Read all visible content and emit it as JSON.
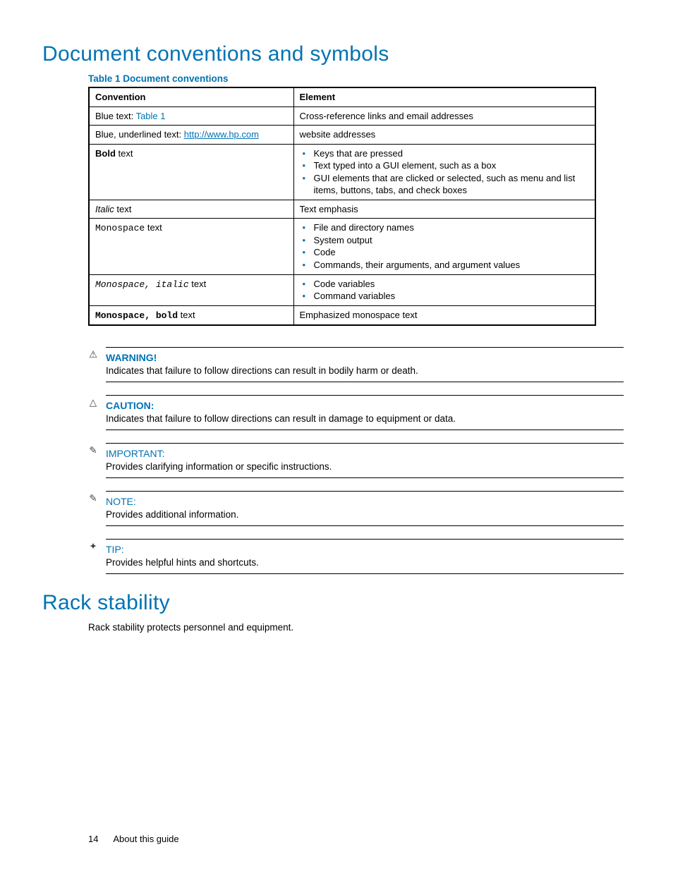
{
  "h1": "Document conventions and symbols",
  "table_caption": "Table 1 Document conventions",
  "thead": {
    "c1": "Convention",
    "c2": "Element"
  },
  "rows": {
    "r1": {
      "conv_pre": "Blue text: ",
      "conv_link": "Table 1",
      "elem": "Cross-reference links and email addresses"
    },
    "r2": {
      "conv_pre": "Blue, underlined text: ",
      "conv_link": "http://www.hp.com",
      "elem": "website addresses"
    },
    "r3": {
      "conv_bold": "Bold",
      "conv_rest": " text",
      "items": {
        "a": "Keys that are pressed",
        "b": "Text typed into a GUI element, such as a box",
        "c": "GUI elements that are clicked or selected, such as menu and list items, buttons, tabs, and check boxes"
      }
    },
    "r4": {
      "conv_italic": "Italic",
      "conv_rest": " text",
      "elem": "Text emphasis"
    },
    "r5": {
      "conv_mono": "Monospace",
      "conv_rest": " text",
      "items": {
        "a": "File and directory names",
        "b": "System output",
        "c": "Code",
        "d": "Commands, their arguments, and argument values"
      }
    },
    "r6": {
      "conv_mono_it": "Monospace, italic",
      "conv_rest": " text",
      "items": {
        "a": "Code variables",
        "b": "Command variables"
      }
    },
    "r7": {
      "conv_mono_bold": "Monospace, bold",
      "conv_rest": " text",
      "elem": "Emphasized monospace text"
    }
  },
  "callouts": {
    "warning": {
      "icon": "⚠",
      "title": "WARNING!",
      "body": "Indicates that failure to follow directions can result in bodily harm or death."
    },
    "caution": {
      "icon": "△",
      "title": "CAUTION:",
      "body": "Indicates that failure to follow directions can result in damage to equipment or data."
    },
    "important": {
      "icon": "✎",
      "title": "IMPORTANT:",
      "body": "Provides clarifying information or specific instructions."
    },
    "note": {
      "icon": "✎",
      "title": "NOTE:",
      "body": "Provides additional information."
    },
    "tip": {
      "icon": "✦",
      "title": "TIP:",
      "body": "Provides helpful hints and shortcuts."
    }
  },
  "h2": "Rack stability",
  "rack_body": "Rack stability protects personnel and equipment.",
  "footer": {
    "page": "14",
    "section": "About this guide"
  }
}
